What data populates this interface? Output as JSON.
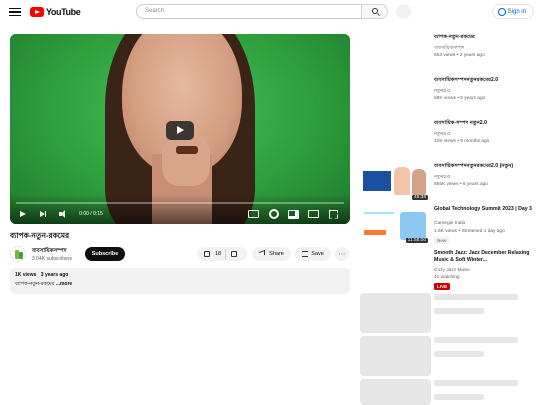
{
  "header": {
    "logo_text": "YouTube",
    "search_placeholder": "Search",
    "signin_label": "Sign in"
  },
  "player": {
    "time_current": "0:00",
    "time_total": "0:15",
    "time_display": "0:00 / 0:15",
    "progress_fraction": 0.0
  },
  "video": {
    "title": "ব্যাপক-নতুন-রকমের",
    "channel_name": "ব্যবসায়িকসম্পদ",
    "subscribers": "3.04K subscribers",
    "subscribe_label": "Subscribe",
    "likes": "18",
    "share_label": "Share",
    "save_label": "Save",
    "views": "1K views",
    "age": "3 years ago",
    "description_snippet": "ব্যাপক-নতুন-রকমের",
    "more_label": "...more"
  },
  "recommendations": [
    {
      "title": "ব্যাপক-নতুন-রকমের",
      "channel": "ব্যবসায়িকসম্পদ",
      "views": "653 views",
      "age": "2 years ago"
    },
    {
      "title": "ব্যবসায়িকসম্পদনতুনরকমের2.0",
      "channel": "নতুন2.0",
      "views": "68K views",
      "age": "5 years ago"
    },
    {
      "title": "ব্যবসায়িক-সম্পদ নতুন2.0",
      "channel": "নতুন2.0",
      "views": "12K views",
      "age": "9 months ago"
    },
    {
      "title": "ব্যবসায়িকসম্পদনতুনরকমের2.0 (নতুন)",
      "channel": "নতুন2.0",
      "views": "855K views",
      "age": "6 years ago",
      "duration": "45:38"
    },
    {
      "title": "Global Technology Summit 2023 | Day 3",
      "channel": "Carnegie India",
      "views": "1.6K views",
      "age": "Streamed 1 day ago",
      "duration": "11:58:00",
      "badge": "New"
    },
    {
      "title": "Smooth Jazz: Jazz December Relaxing Music & Soft Winter...",
      "channel": "Cozy Jazz Music",
      "watching": "41 watching",
      "badge": "LIVE"
    }
  ],
  "colors": {
    "brand_red": "#ff0000",
    "link_blue": "#065fd4",
    "live_red": "#cc0000",
    "green_screen": "#2f9e3d"
  }
}
